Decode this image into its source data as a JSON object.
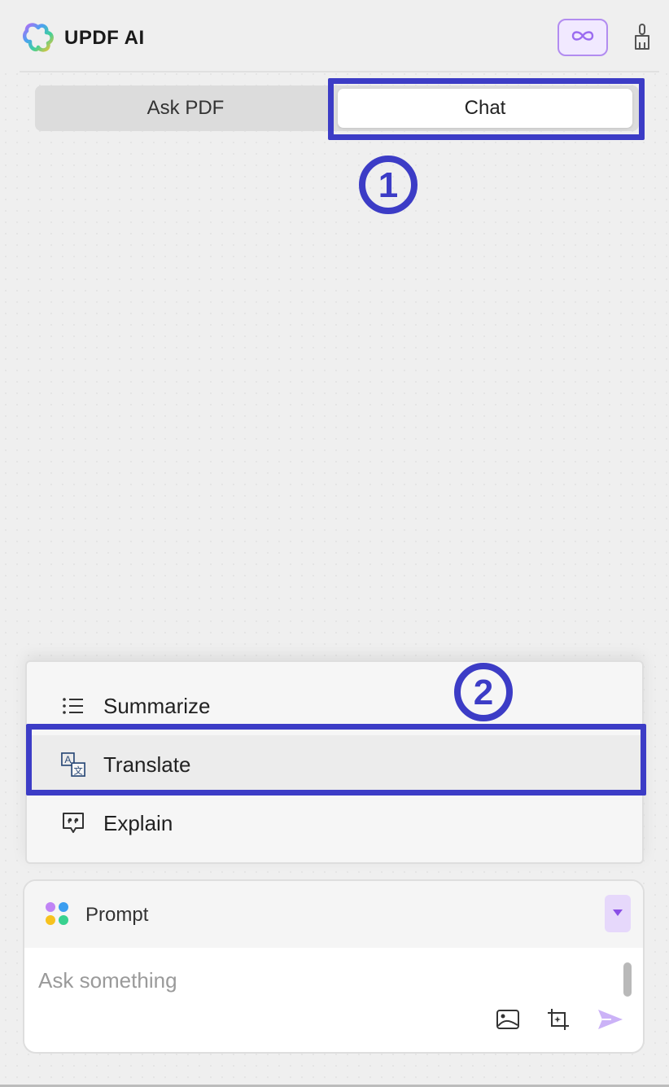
{
  "header": {
    "app_title": "UPDF AI",
    "logo_icon": "updf-ai-logo-icon",
    "infinity_icon": "infinity-icon",
    "clear_icon": "broom-icon"
  },
  "tabs": [
    {
      "label": "Ask PDF",
      "active": false
    },
    {
      "label": "Chat",
      "active": true
    }
  ],
  "annotations": {
    "step_1": "①",
    "step_2": "②",
    "highlight_color": "#3c3cc6"
  },
  "quick_actions": {
    "items": [
      {
        "label": "Summarize",
        "icon": "list-icon"
      },
      {
        "label": "Translate",
        "icon": "translate-icon",
        "highlighted": true
      },
      {
        "label": "Explain",
        "icon": "explain-icon"
      }
    ]
  },
  "composer": {
    "prompt_label": "Prompt",
    "prompt_icon": "prompt-dots-icon",
    "dropdown_icon": "caret-down-icon",
    "input_placeholder": "Ask something",
    "input_value": "",
    "image_icon": "image-icon",
    "crop_icon": "screenshot-crop-icon",
    "send_icon": "send-icon"
  },
  "colors": {
    "accent_purple": "#b28cf0",
    "accent_purple_bg": "#f1e9ff",
    "annotation_blue": "#3c3cc6"
  }
}
